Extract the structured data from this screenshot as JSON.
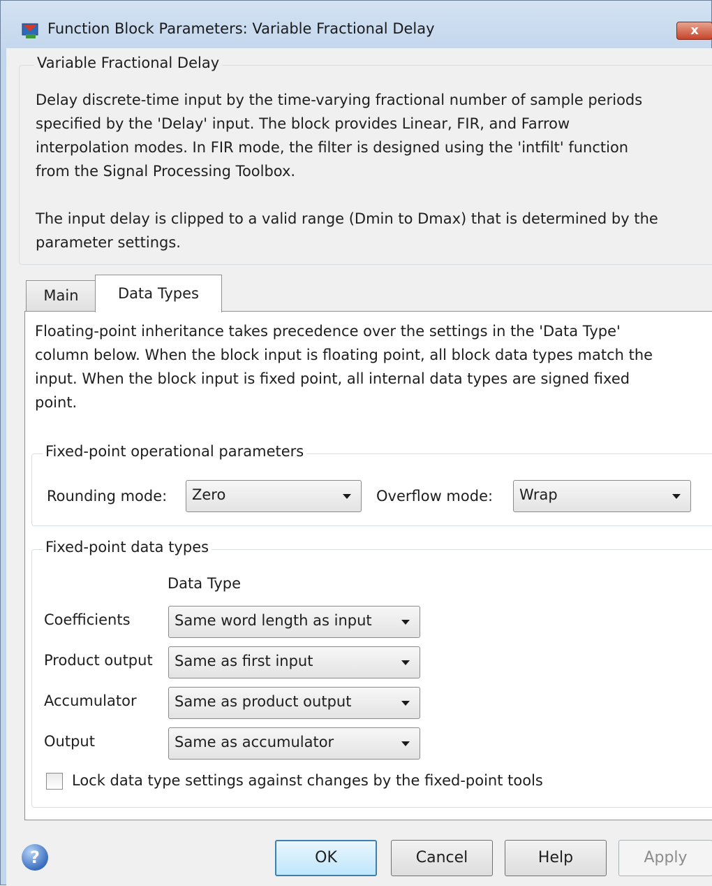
{
  "window": {
    "title": "Function Block Parameters: Variable Fractional Delay",
    "close_label": "x"
  },
  "description": {
    "group_title": "Variable Fractional Delay",
    "paragraph1": "Delay discrete-time input by the time-varying fractional number of sample periods\nspecified by the 'Delay' input. The block provides Linear, FIR, and Farrow\ninterpolation modes. In FIR mode, the filter is designed using the 'intfilt' function\nfrom the Signal Processing Toolbox.",
    "paragraph2": "The input delay is clipped to a valid range (Dmin to Dmax) that is determined by the\nparameter settings."
  },
  "tabs": [
    {
      "label": "Main",
      "selected": false
    },
    {
      "label": "Data Types",
      "selected": true
    }
  ],
  "data_types": {
    "intro": "Floating-point inheritance takes precedence over the settings in the 'Data Type'\ncolumn below. When the block input is floating point, all block data types match the\ninput. When the block input is fixed point, all internal data types are signed fixed\npoint.",
    "operational": {
      "group_title": "Fixed-point operational parameters",
      "rounding_label": "Rounding mode:",
      "rounding_value": "Zero",
      "overflow_label": "Overflow mode:",
      "overflow_value": "Wrap"
    },
    "types": {
      "group_title": "Fixed-point data types",
      "column_header": "Data Type",
      "rows": [
        {
          "label": "Coefficients",
          "value": "Same word length as input"
        },
        {
          "label": "Product output",
          "value": "Same as first input"
        },
        {
          "label": "Accumulator",
          "value": "Same as product output"
        },
        {
          "label": "Output",
          "value": "Same as accumulator"
        }
      ],
      "lock_label": "Lock data type settings against changes by the fixed-point tools",
      "lock_checked": false
    }
  },
  "buttons": {
    "help_icon": "?",
    "ok": "OK",
    "cancel": "Cancel",
    "help": "Help",
    "apply": "Apply"
  }
}
